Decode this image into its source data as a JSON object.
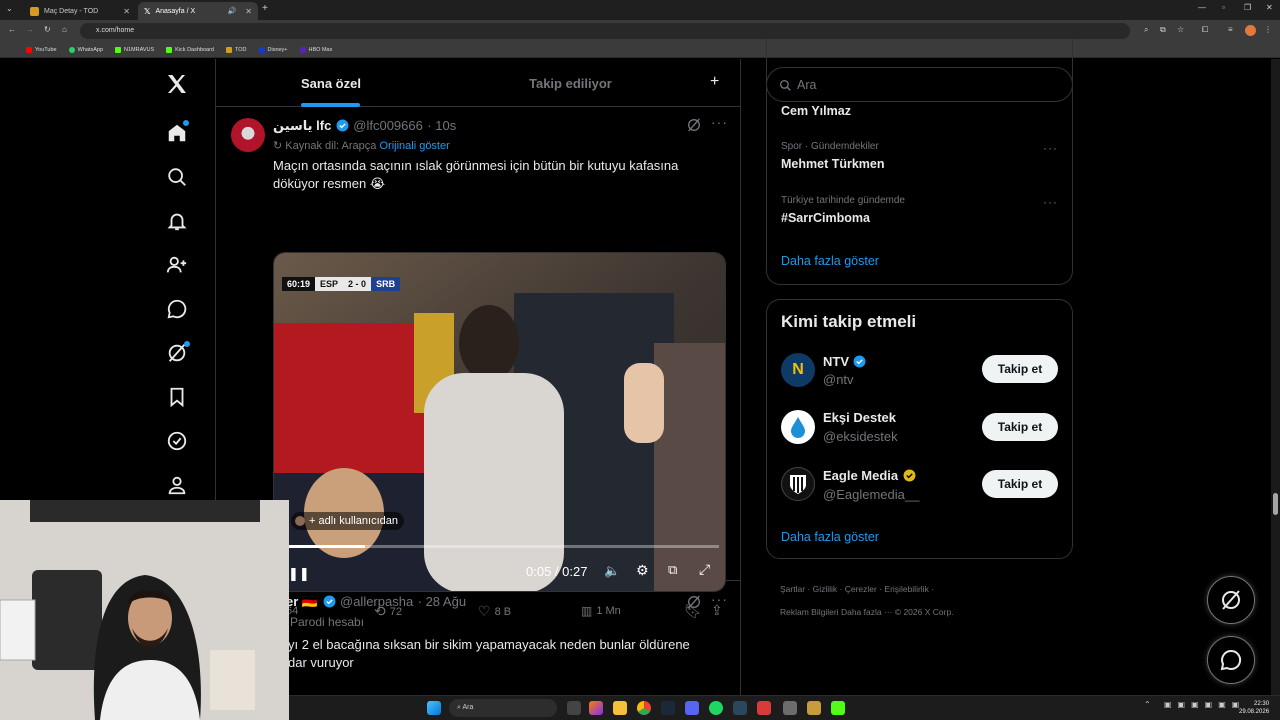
{
  "browser": {
    "tabs": [
      {
        "title": "Maç Detay - TOD"
      },
      {
        "title": "Anasayfa / X"
      }
    ],
    "url": "x.com/home",
    "bookmarks": [
      "YouTube",
      "WhatsApp",
      "N1MRAVUS",
      "Kick Dashboard",
      "TOD",
      "Disney+",
      "HBO Max"
    ]
  },
  "timeline": {
    "tabs": {
      "for_you": "Sana özel",
      "following": "Takip ediliyor"
    },
    "tweet1": {
      "name": "ياسين lfc",
      "handle": "@lfc009666",
      "time": "· 10s",
      "translation_prefix": "Kaynak dil: Arapça",
      "translation_link": "Orijinali göster",
      "text": "Maçın ortasında saçının ıslak görünmesi için bütün bir kutuyu kafasına döküyor resmen 😭",
      "video": {
        "clock": "60:19",
        "team_home": "ESP",
        "score": "2 - 0",
        "team_away": "SRB",
        "tagged": "+ adlı kullanıcıdan",
        "time_display": "0:05 / 0:27",
        "progress": 0.19
      },
      "stats": {
        "replies": "64",
        "reposts": "72",
        "likes": "8 B",
        "views": "1 Mn"
      }
    },
    "tweet2": {
      "name": "er 🇩🇪",
      "handle": "@allerpasha",
      "time": "· 28 Ağu",
      "label": "Parodi hesabı",
      "text": "yı 2 el bacağına sıksan bir sikim yapamayacak neden bunlar öldürene dar vuruyor"
    }
  },
  "sidebar": {
    "search_placeholder": "Ara",
    "trends": [
      {
        "meta": "",
        "name": "Cem Yılmaz"
      },
      {
        "meta": "Spor · Gündemdekiler",
        "name": "Mehmet Türkmen"
      },
      {
        "meta": "Türkiye tarihinde gündemde",
        "name": "#SarrCimboma"
      }
    ],
    "trends_more": "Daha fazla göster",
    "who_to_follow": {
      "title": "Kimi takip etmeli",
      "accounts": [
        {
          "name": "NTV",
          "handle": "@ntv",
          "badge": "blue"
        },
        {
          "name": "Ekşi Destek",
          "handle": "@eksidestek",
          "badge": ""
        },
        {
          "name": "Eagle Media",
          "handle": "@Eaglemedia__",
          "badge": "gold"
        }
      ],
      "follow_label": "Takip et",
      "more": "Daha fazla göster"
    },
    "footer": {
      "terms": "Şartlar",
      "privacy": "Gizlilik",
      "cookies": "Çerezler",
      "accessibility": "Erişilebilirlik",
      "ads": "Reklam Bilgileri",
      "more": "Daha fazla ···",
      "copyright": "© 2026 X Corp."
    }
  },
  "taskbar": {
    "search": "Ara",
    "time": "22:30",
    "date": "29.08.2026"
  },
  "colors": {
    "accent": "#1d9bf0",
    "background": "#000000",
    "gold_badge": "#e2b719"
  }
}
